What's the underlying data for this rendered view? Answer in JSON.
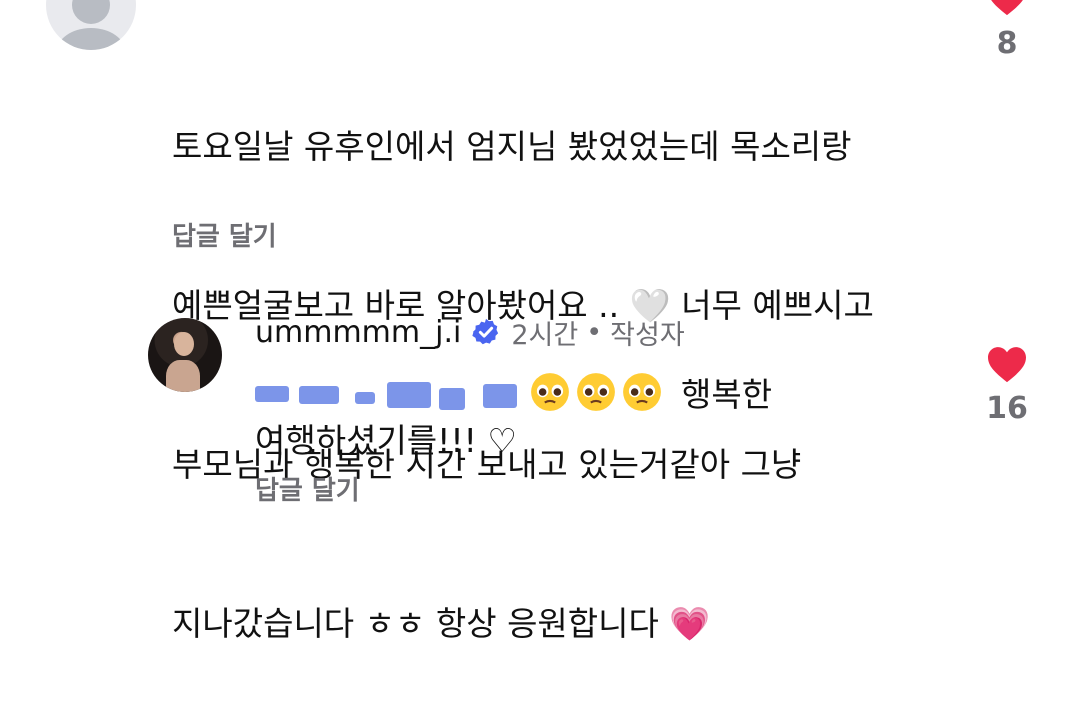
{
  "comment1": {
    "lines": [
      "토요일날 유후인에서 엄지님 봤었었는데 목소리랑",
      "예쁜얼굴보고 바로 알아봤어요 .. 🤍 너무 예쁘시고",
      "부모님과 행복한 시간 보내고 있는거같아 그냥",
      "지나갔습니다 ㅎㅎ 항상 응원합니다 💗"
    ],
    "reply_label": "답글 달기",
    "like_count": "8"
  },
  "comment2": {
    "username": "ummmmm_j.i",
    "time": "2시간",
    "separator": "•",
    "author_badge": "작성자",
    "text_line1": "행복한",
    "text_line2": "여행하셨기를!!! ♡",
    "reply_label": "답글 달기",
    "like_count": "16"
  },
  "colors": {
    "like": "#ed2a4a",
    "verified": "#4a65f0",
    "secondary_text": "#6e6e73"
  },
  "icons": [
    "default-avatar-icon",
    "heart-icon",
    "verified-badge-icon",
    "pleading-face-emoji"
  ]
}
